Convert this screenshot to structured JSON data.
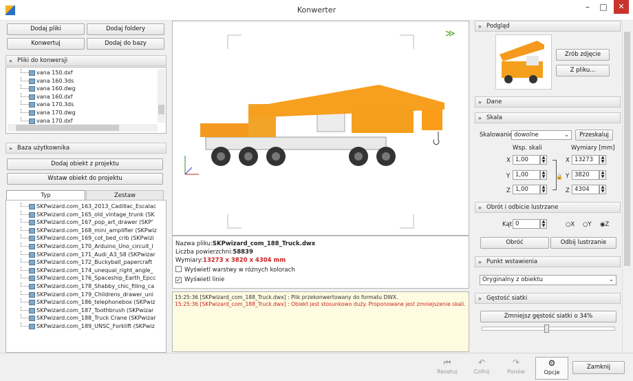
{
  "window": {
    "title": "Konwerter",
    "minimize": "–",
    "maximize": "□",
    "close": "✕"
  },
  "left": {
    "buttons": {
      "add_files": "Dodaj pliki",
      "add_folders": "Dodaj foldery",
      "convert": "Konwertuj",
      "add_to_db": "Dodaj do bazy"
    },
    "files_panel": {
      "title": "Pliki do konwersji",
      "items": [
        "vana 150.dxf",
        "vana 160.3ds",
        "vana 160.dwg",
        "vana 160.dxf",
        "vana 170.3ds",
        "vana 170.dwg",
        "vana 170.dxf"
      ]
    },
    "user_db": {
      "title": "Baza użytkownika",
      "add_from_project": "Dodaj obiekt z projektu",
      "insert_to_project": "Wstaw obiekt do projektu",
      "tabs": [
        "Typ",
        "Zestaw"
      ],
      "items": [
        "SKPwizard.com_163_2013_Cadillac_Escalac",
        "SKPwizard.com_165_old_vintage_trunk (SK",
        "SKPwizard.com_167_pop_art_drawer (SKP’",
        "SKPwizard.com_168_mini_amplifier (SKPwiz",
        "SKPwizard.com_169_cot_bed_crib (SKPwizi",
        "SKPwizard.com_170_Arduino_Uno_circuit_l",
        "SKPwizard.com_171_Audi_A3_S8 (SKPwizar",
        "SKPwizard.com_172_Buckyball_papercraft",
        "SKPwizard.com_174_unequal_right_angle_",
        "SKPwizard.com_176_Spaceship_Earth_Epcc",
        "SKPwizard.com_178_Shabby_chic_filing_ca",
        "SKPwizard.com_179_Childrens_drawer_uni",
        "SKPwizard.com_186_telephonebox (SKPwiz",
        "SKPwizard.com_187_Toothbrush (SKPwizar",
        "SKPwizard.com_188_Truck Crane (SKPwizar",
        "SKPwizard.com_189_UNSC_Forklift (SKPwiz"
      ]
    }
  },
  "center": {
    "info": {
      "filename_label": "Nazwa pliku:",
      "filename": "SKPwizard_com_188_Truck.dwx",
      "faces_label": "Liczba powierzchni:",
      "faces": "58839",
      "dims_label": "Wymiary:",
      "dims": "13273 x 3820 x 4304 mm"
    },
    "checkboxes": {
      "layers": "Wyświetl warstwy w różnych kolorach",
      "lines": "Wyświetl linie"
    },
    "log": [
      {
        "time": "15:25:36",
        "text": " [SKPwizard_com_188_Truck.dwx] : Plik przekonwertowany do formatu DWX.",
        "color": "#333333"
      },
      {
        "time": "15:25:36",
        "text": " [SKPwizard_com_188_Truck.dwx] : Obiekt jest stosunkowo duży. Proponowane jest zmniejszenie skali.",
        "color": "#cc2222"
      }
    ]
  },
  "right": {
    "preview": {
      "title": "Podgląd",
      "snapshot": "Zrób zdjęcie",
      "from_file": "Z pliku..."
    },
    "data": {
      "title": "Dane"
    },
    "scale": {
      "title": "Skala",
      "scaling_label": "Skalowanie",
      "scaling_value": "dowolne",
      "rescale": "Przeskaluj",
      "coef_label": "Wsp. skali",
      "dims_label": "Wymiary [mm]",
      "x": "1,00",
      "y": "1,00",
      "z": "1,00",
      "dx": "13273",
      "dy": "3820",
      "dz": "4304"
    },
    "rotation": {
      "title": "Obrót i odbicie lustrzane",
      "angle_label": "Kąt [°]",
      "angle": "0",
      "axes": [
        "X",
        "Y",
        "Z"
      ],
      "rotate": "Obróć",
      "mirror": "Odbij lustrzanie"
    },
    "insertion": {
      "title": "Punkt wstawienia",
      "value": "Oryginalny z obiektu"
    },
    "mesh": {
      "title": "Gęstość siatki",
      "reduce": "Zmniejsz gęstość siatki o 34%"
    }
  },
  "toolbar": {
    "reset": "Resetuj",
    "undo": "Cofnij",
    "redo": "Ponów",
    "options": "Opcje",
    "close": "Zamknij"
  }
}
